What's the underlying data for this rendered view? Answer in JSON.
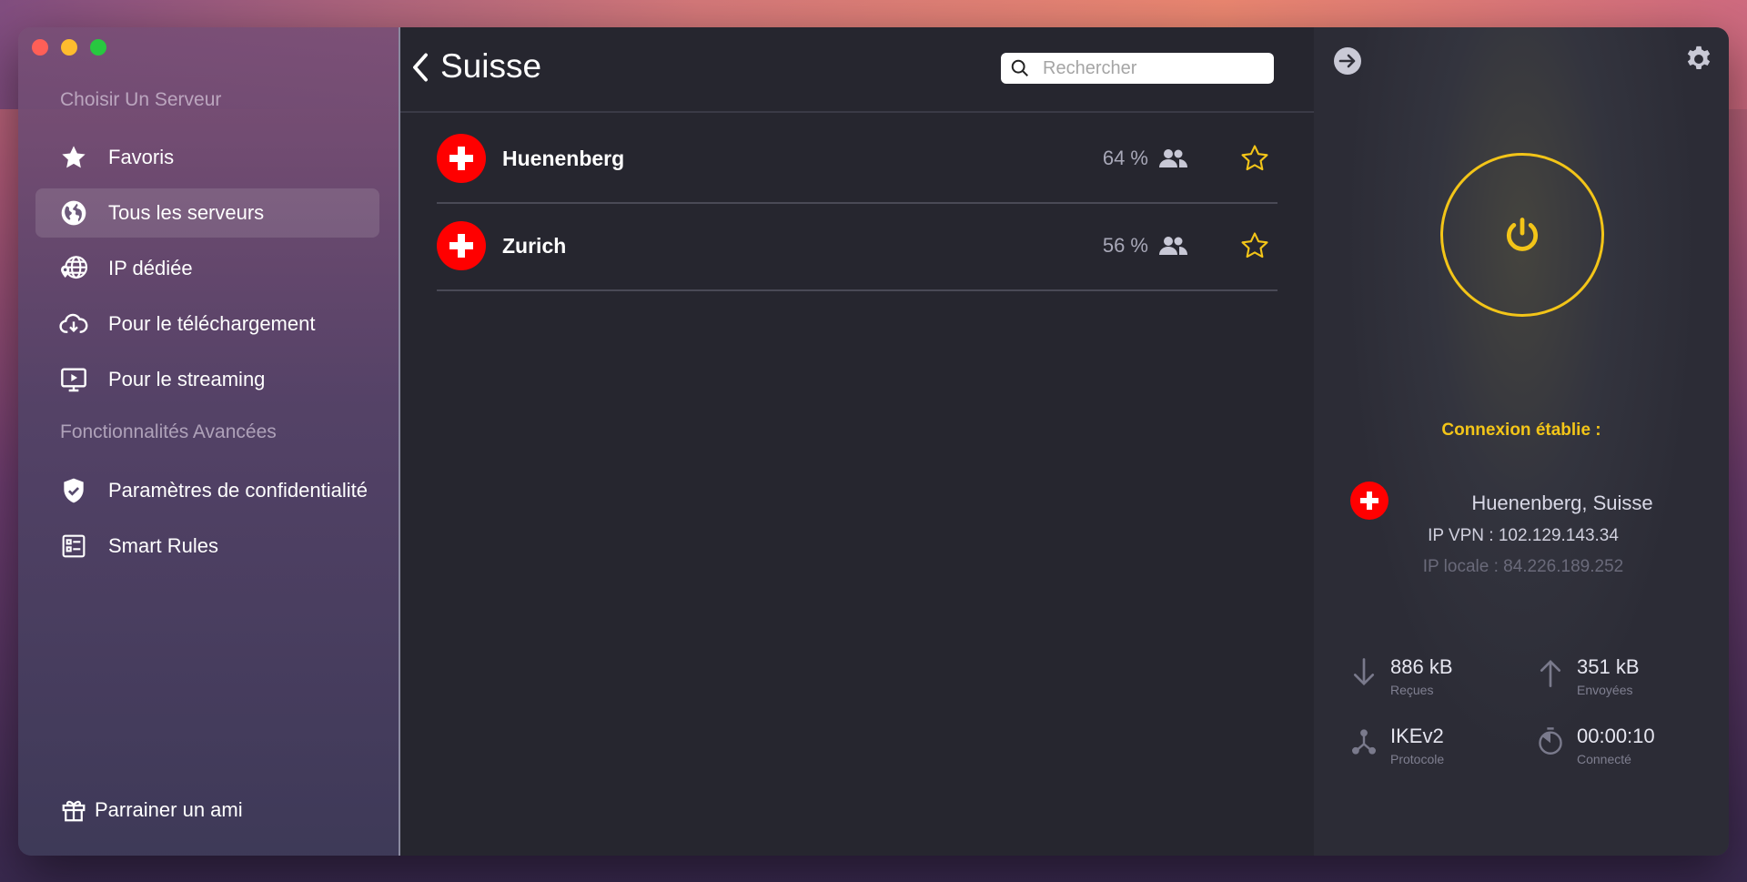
{
  "sidebar": {
    "section_servers": "Choisir Un Serveur",
    "items": [
      {
        "label": "Favoris",
        "icon": "star-icon"
      },
      {
        "label": "Tous les serveurs",
        "icon": "globe-icon"
      },
      {
        "label": "IP dédiée",
        "icon": "dedicated-ip-icon"
      },
      {
        "label": "Pour le téléchargement",
        "icon": "cloud-download-icon"
      },
      {
        "label": "Pour le streaming",
        "icon": "streaming-icon"
      }
    ],
    "section_advanced": "Fonctionnalités Avancées",
    "advanced_items": [
      {
        "label": "Paramètres de confidentialité",
        "icon": "shield-icon"
      },
      {
        "label": "Smart Rules",
        "icon": "rules-icon"
      }
    ],
    "refer_label": "Parrainer un ami",
    "active_index": 1
  },
  "main": {
    "title": "Suisse",
    "search_placeholder": "Rechercher",
    "servers": [
      {
        "name": "Huenenberg",
        "load": "64 %"
      },
      {
        "name": "Zurich",
        "load": "56 %"
      }
    ]
  },
  "panel": {
    "status": "Connexion établie :",
    "location": "Huenenberg, Suisse",
    "ip_vpn": "IP VPN : 102.129.143.34",
    "ip_local": "IP locale : 84.226.189.252",
    "received_value": "886 kB",
    "received_label": "Reçues",
    "sent_value": "351 kB",
    "sent_label": "Envoyées",
    "protocol_value": "IKEv2",
    "protocol_label": "Protocole",
    "time_value": "00:00:10",
    "time_label": "Connecté"
  },
  "colors": {
    "accent": "#f3c518",
    "flag_red": "#ff0000",
    "list_bg": "#26262f"
  }
}
